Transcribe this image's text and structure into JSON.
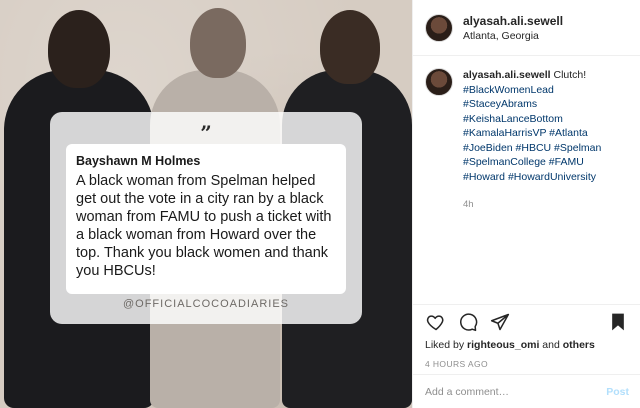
{
  "post": {
    "quote": {
      "author": "Bayshawn M Holmes",
      "text": "A black woman from Spelman helped get out the vote in a city ran by a black woman from FAMU to push a ticket with a black woman from Howard over the top.  Thank you black women and thank you HBCUs!",
      "handle": "@OFFICIALCOCOADIARIES",
      "quote_glyph": "”"
    }
  },
  "header": {
    "username": "alyasah.ali.sewell",
    "location": "Atlanta, Georgia"
  },
  "caption": {
    "username": "alyasah.ali.sewell",
    "text": "Clutch!",
    "hashtags": "#BlackWomenLead #StaceyAbrams #KeishaLanceBottom #KamalaHarrisVP #Atlanta #JoeBiden #HBCU #Spelman #SpelmanCollege #FAMU #Howard #HowardUniversity",
    "time": "4h"
  },
  "actions": {
    "icons": [
      "heart-icon",
      "comment-icon",
      "share-icon",
      "bookmark-icon"
    ],
    "liked_by_prefix": "Liked by",
    "liked_by_user": "righteous_omi",
    "liked_by_connector": "and",
    "liked_by_suffix": "others",
    "posted_time": "4 HOURS AGO"
  },
  "comment": {
    "placeholder": "Add a comment…",
    "post_label": "Post"
  },
  "colors": {
    "link": "#00376b",
    "post_button": "#b2dffc",
    "muted": "#8e8e8e"
  }
}
